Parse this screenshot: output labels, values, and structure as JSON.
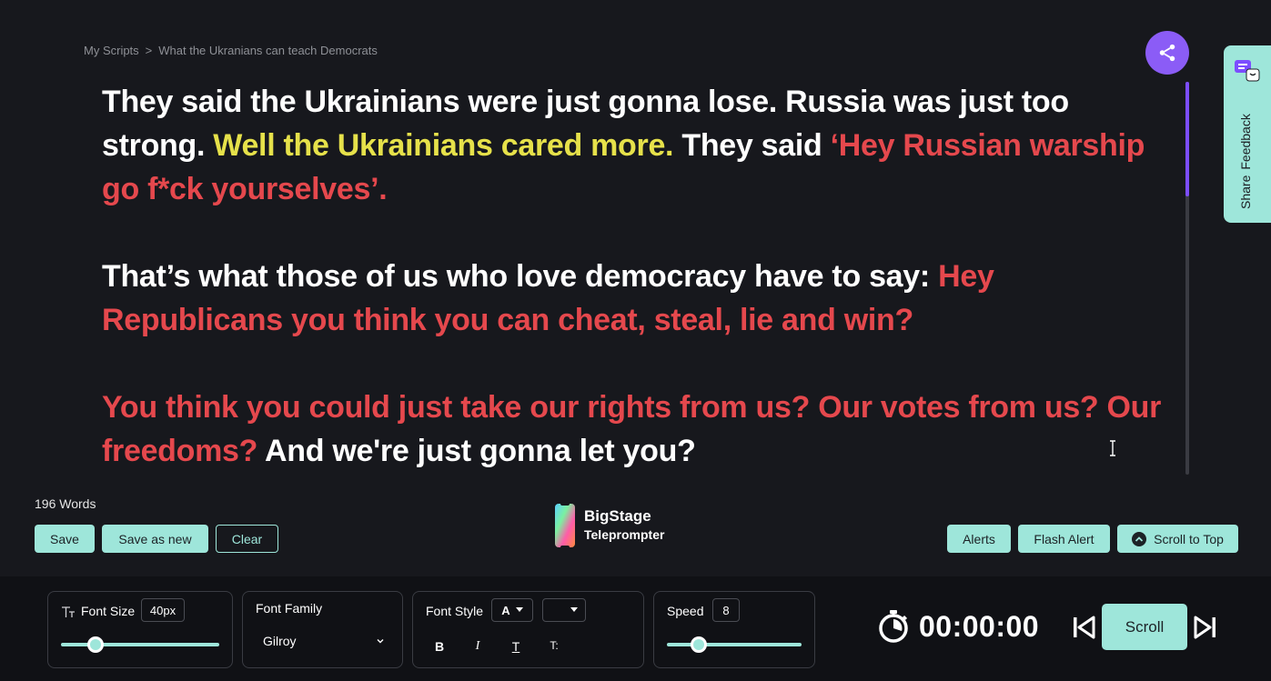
{
  "breadcrumb": {
    "root": "My Scripts",
    "separator": ">",
    "current": "What the Ukranians can teach Democrats"
  },
  "feedback": {
    "word1": "Share",
    "word2": "Feedback"
  },
  "script": {
    "paragraphs": [
      [
        {
          "text": "They said the Ukrainians were just gonna lose. Russia was just too strong. ",
          "color": "white"
        },
        {
          "text": "Well the Ukrainians cared more.",
          "color": "yellow"
        },
        {
          "text": " They said ",
          "color": "white"
        },
        {
          "text": "‘Hey Russian warship go f*ck yourselves’.",
          "color": "red"
        }
      ],
      [
        {
          "text": "That’s what those of us who love democracy have to say: ",
          "color": "white"
        },
        {
          "text": "Hey Republicans you think you can cheat, steal, lie and win?",
          "color": "red"
        }
      ],
      [
        {
          "text": "You think you could just take our rights from us? Our votes from us? Our freedoms?",
          "color": "red"
        },
        {
          "text": " And we're just gonna let you?",
          "color": "white"
        }
      ]
    ]
  },
  "word_count": "196 Words",
  "actions": {
    "save": "Save",
    "save_as_new": "Save as new",
    "clear": "Clear"
  },
  "logo": {
    "line1": "BigStage",
    "line2": "Teleprompter"
  },
  "right_actions": {
    "alerts": "Alerts",
    "flash_alert": "Flash Alert",
    "scroll_to_top": "Scroll to Top"
  },
  "controls": {
    "font_size": {
      "label": "Font Size",
      "value": "40px"
    },
    "font_family": {
      "label": "Font Family",
      "value": "Gilroy"
    },
    "font_style": {
      "label": "Font Style",
      "color_value": "A",
      "bold": "B",
      "italic": "I",
      "strike": "T",
      "caps": "T:"
    },
    "speed": {
      "label": "Speed",
      "value": "8"
    }
  },
  "timer": {
    "value": "00:00:00"
  },
  "scroll_label": "Scroll",
  "colors": {
    "accent": "#9ee6da",
    "purple": "#8b5cf6",
    "yellow": "#e6e14a",
    "red": "#e5484d"
  }
}
